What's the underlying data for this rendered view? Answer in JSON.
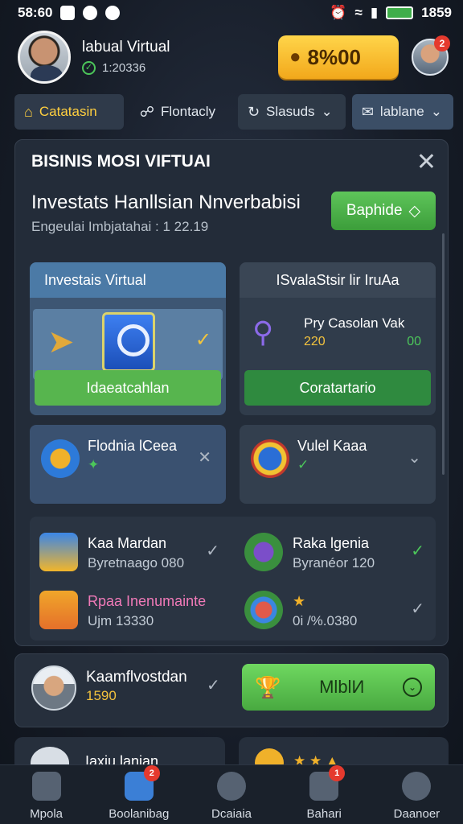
{
  "status_bar": {
    "time": "58:60",
    "clock_right": "1859"
  },
  "header": {
    "user_name": "labual Virtual",
    "user_id": "1:20336",
    "coins": "8%00",
    "avatar_badge": "2"
  },
  "tabs": [
    {
      "label": "Catatasin",
      "icon": "home-icon"
    },
    {
      "label": "Flontacly",
      "icon": "link-icon"
    },
    {
      "label": "Slasuds",
      "icon": "refresh-icon"
    },
    {
      "label": "lablane",
      "icon": "mail-icon"
    }
  ],
  "panel": {
    "title": "BISINIS MOSI VIFTUAI",
    "section_title": "Investats Hanllsian Nnverbabisi",
    "section_sub": "Engeulai Imbjatahai : 1 22.19",
    "action_button": "Baphide",
    "card_a": {
      "header": "Investais Virtual",
      "button": "Idaeatcahlan"
    },
    "card_b": {
      "header": "ISvalaStsir lir IruAa",
      "item_name": "Pry Casolan Vak",
      "item_value": "220",
      "item_value_right": "00",
      "button": "Coratartario"
    },
    "card_c": {
      "name": "Flodnia lCeea"
    },
    "card_d": {
      "name": "Vulel Kaaa"
    },
    "list": [
      {
        "name": "Kaa Mardan",
        "sub": "Byretnaago 080"
      },
      {
        "name": "Raka lgenia",
        "sub": "Byranéor 120"
      },
      {
        "name": "Rpaa Inenumainte",
        "sub": "Ujm 13330"
      },
      {
        "name": "",
        "sub": "0i /%.0380"
      }
    ]
  },
  "footer_card": {
    "name": "Kaamflvostdan",
    "number": "1590",
    "button": "MlblИ"
  },
  "peek": {
    "name": "Iaxiu lanian"
  },
  "bottom_nav": [
    {
      "label": "Mpola",
      "badge": ""
    },
    {
      "label": "Boolanibag",
      "badge": "2"
    },
    {
      "label": "Dcaiaia",
      "badge": ""
    },
    {
      "label": "Bahari",
      "badge": "1"
    },
    {
      "label": "Daanoer",
      "badge": ""
    }
  ]
}
